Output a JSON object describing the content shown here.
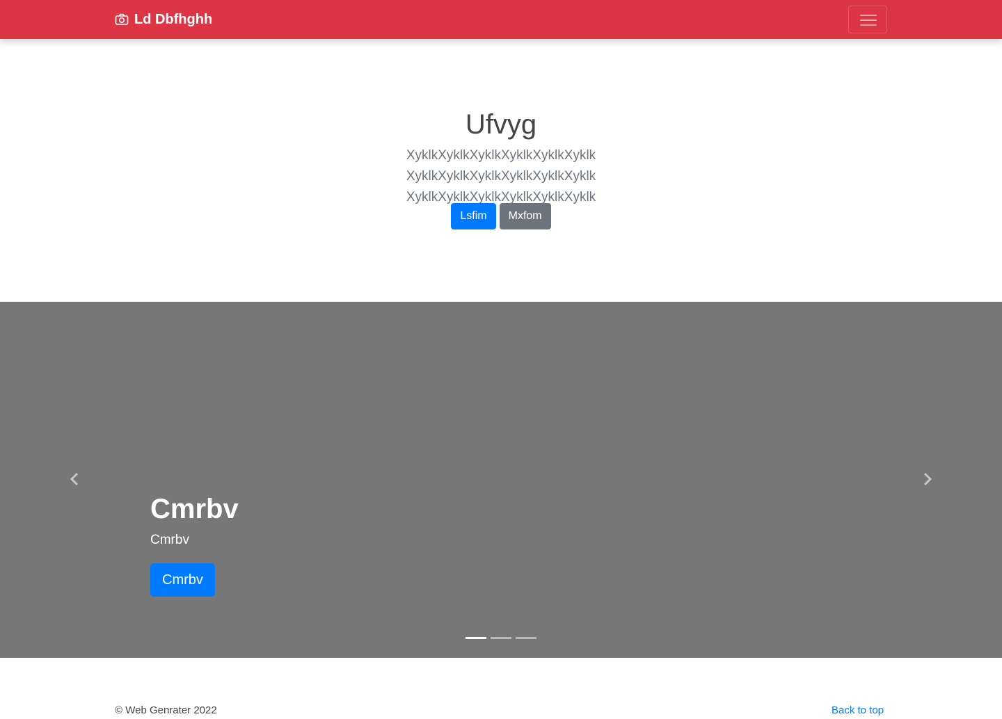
{
  "navbar": {
    "brand": "Ld Dbfhghh",
    "brand_icon": "camera-icon",
    "toggler_icon": "hamburger-menu-icon",
    "background_color": "#dc3545"
  },
  "hero": {
    "title": "Ufvyg",
    "lead": "XyklkXyklkXyklkXyklkXyklkXyklk XyklkXyklkXyklkXyklkXyklkXyklk XyklkXyklkXyklkXyklkXyklkXyklk",
    "primary_button": "Lsfim",
    "secondary_button": "Mxfom"
  },
  "carousel": {
    "caption_title": "Cmrbv",
    "caption_text": "Cmrbv",
    "caption_button": "Cmrbv",
    "prev_icon": "chevron-left-icon",
    "next_icon": "chevron-right-icon",
    "slide_count": 3,
    "active_index": 0,
    "background_color": "#777777"
  },
  "footer": {
    "copyright": "© Web Genrater 2022",
    "back_to_top": "Back to top"
  }
}
